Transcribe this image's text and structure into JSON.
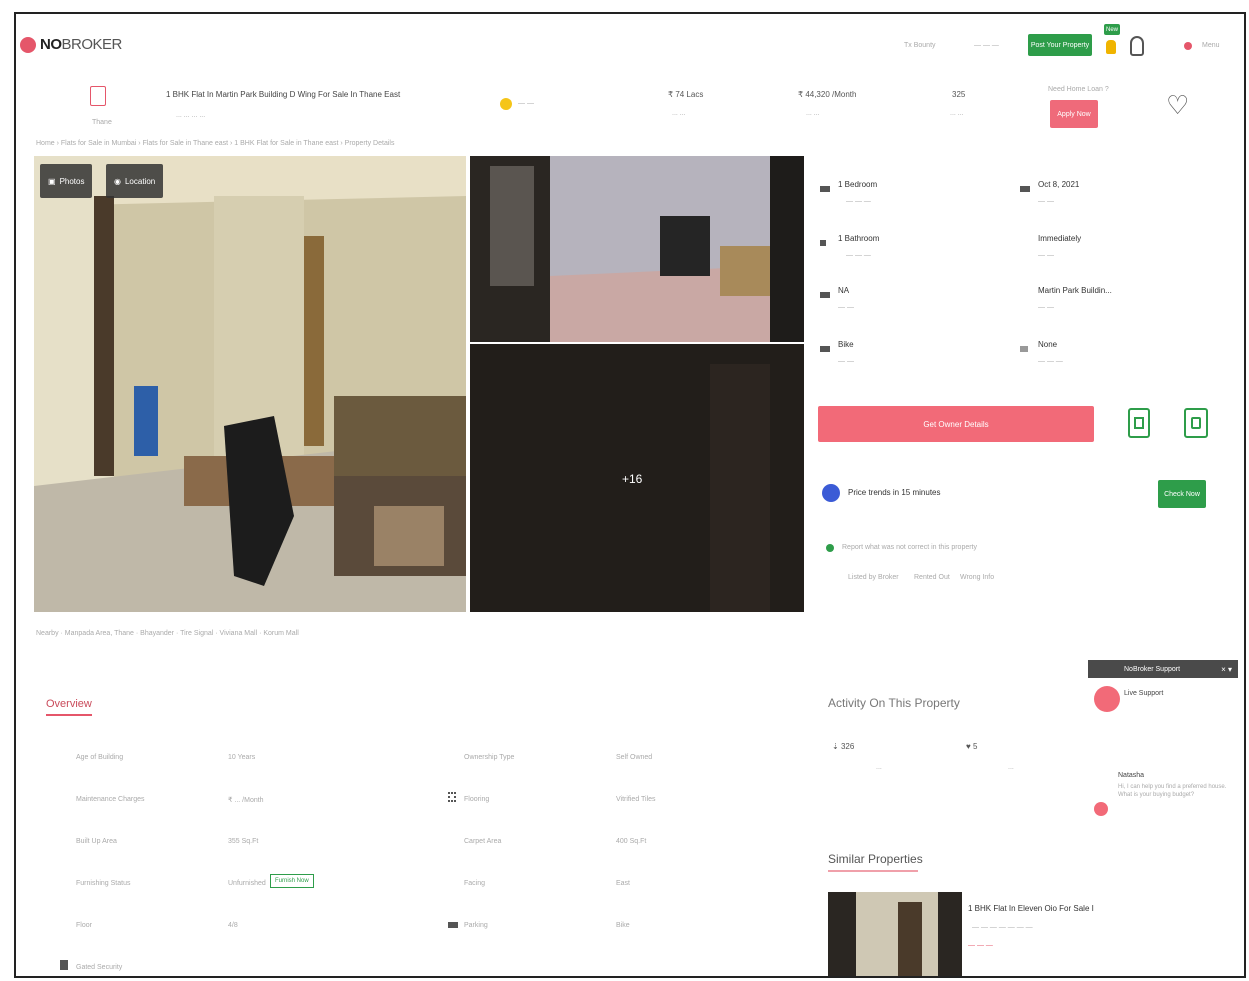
{
  "header": {
    "logo_bold": "NO",
    "logo_light": "BROKER",
    "nav": [
      "Tx Bounty",
      "— — —"
    ],
    "post_property_label": "Post Your Property",
    "new_badge": "New",
    "menu_label": "Menu"
  },
  "summary": {
    "home_label": "Thane",
    "title": "1 BHK Flat In Martin Park Building D Wing For Sale In Thane East",
    "subtitle": "... ... ... ...",
    "owner_chip": "— —",
    "price": "₹ 74 Lacs",
    "price_sub": "... ...",
    "emi": "₹ 44,320 /Month",
    "emi_sub": "... ...",
    "area": "325",
    "area_sub": "... ...",
    "loan_q": "Need Home Loan ?",
    "loan_button": "Apply Now"
  },
  "breadcrumb": "Home  ›  Flats for Sale in Mumbai  ›  Flats for Sale in Thane east  ›  1 BHK Flat for Sale in Thane east  ›  Property Details",
  "gallery": {
    "photos_tag": "Photos",
    "location_tag": "Location",
    "more_count": "+16"
  },
  "features": [
    {
      "label": "1 Bedroom",
      "sub": "— — —"
    },
    {
      "label": "Oct 8, 2021",
      "sub": "— —"
    },
    {
      "label": "1 Bathroom",
      "sub": "— — —"
    },
    {
      "label": "Immediately",
      "sub": "— —"
    },
    {
      "label": "NA",
      "sub": "— —"
    },
    {
      "label": "Martin Park Buildin...",
      "sub": "— —"
    },
    {
      "label": "Bike",
      "sub": "— —"
    },
    {
      "label": "None",
      "sub": "— — —"
    }
  ],
  "contact": {
    "primary_button": "Get Owner Details",
    "price_trends": "Price trends in 15 minutes",
    "check_button": "Check Now",
    "report": "Report what was not correct in this property",
    "report_options": [
      "Listed by Broker",
      "Rented Out",
      "Wrong Info"
    ]
  },
  "nearby": "Nearby  ·  Manpada Area, Thane  ·  Bhayander  ·  Tire Signal  ·  Viviana Mall  ·  Korum Mall",
  "overview": {
    "tab": "Overview",
    "rows": [
      {
        "label": "Age of Building",
        "value": "10 Years",
        "label2": "Ownership Type",
        "value2": "Self Owned"
      },
      {
        "label": "Maintenance Charges",
        "value": "₹ ... /Month",
        "label2": "Flooring",
        "value2": "Vitrified Tiles"
      },
      {
        "label": "Built Up Area",
        "value": "355 Sq.Ft",
        "label2": "Carpet Area",
        "value2": "400 Sq.Ft"
      },
      {
        "label": "Furnishing Status",
        "value": "Unfurnished",
        "label2": "Facing",
        "value2": "East"
      },
      {
        "label": "Floor",
        "value": "4/8",
        "label2": "Parking",
        "value2": "Bike"
      },
      {
        "label": "Gated Security",
        "value": "",
        "label2": "",
        "value2": ""
      }
    ],
    "furnish_button": "Furnish Now"
  },
  "activity": {
    "title": "Activity On This Property",
    "views": "326",
    "views_sub": "...",
    "shortlist": "5",
    "shortlist_sub": "..."
  },
  "similar": {
    "title": "Similar Properties",
    "item_title": "1 BHK Flat In Eleven Oio For Sale I",
    "item_sub": "— — — — — — —",
    "item_tag": "— — —"
  },
  "chat": {
    "header": "NoBroker Support",
    "agent_title": "Live Support",
    "agent_name": "Natasha",
    "message": "Hi, I can help you find a preferred house. What is your buying budget?"
  }
}
